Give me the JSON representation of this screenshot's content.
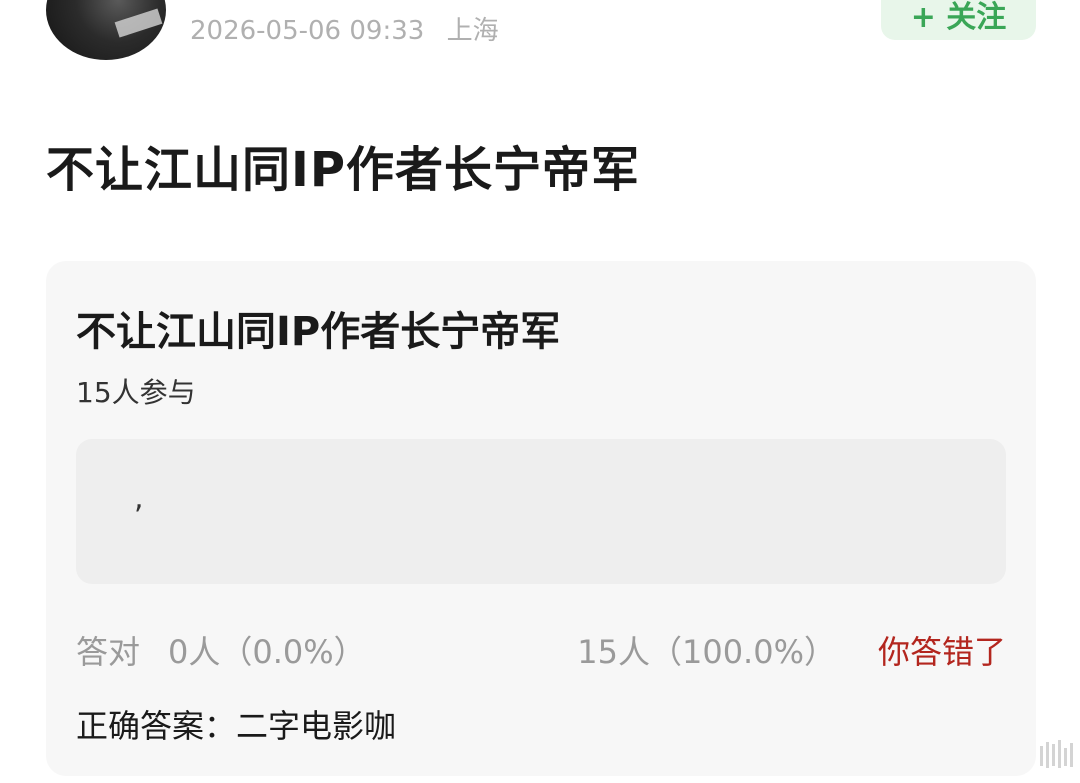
{
  "header": {
    "timestamp": "2026-05-06 09:33",
    "location": "上海",
    "follow_label": "+ 关注"
  },
  "post": {
    "title": "不让江山同IP作者长宁帝军"
  },
  "quiz": {
    "title": "不让江山同IP作者长宁帝军",
    "participants": "15人参与",
    "option_text": ",",
    "correct_label": "答对",
    "correct_count": "0人（0.0%）",
    "wrong_count": "15人（100.0%）",
    "result_text": "你答错了",
    "correct_answer": "正确答案：二字电影咖"
  },
  "colors": {
    "accent_green": "#3aa657",
    "error_red": "#b3261e"
  }
}
